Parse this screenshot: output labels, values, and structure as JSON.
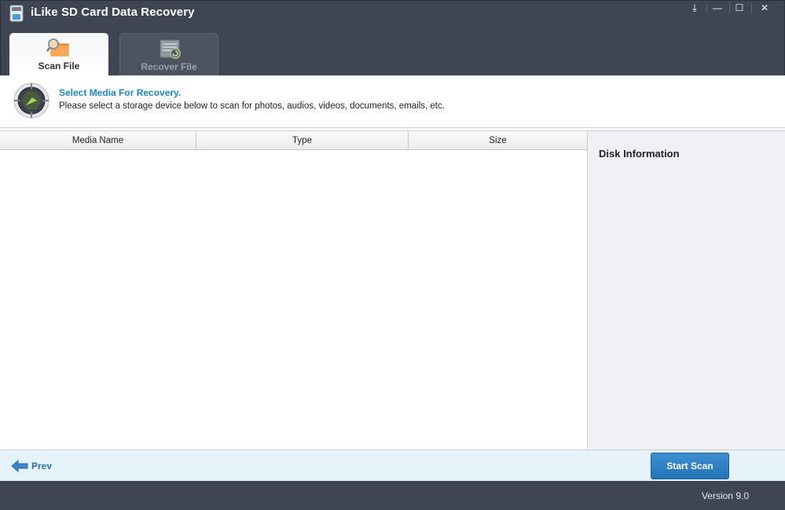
{
  "app": {
    "title": "iLike SD Card Data Recovery"
  },
  "window_controls": [
    {
      "name": "download-icon",
      "glyph": "⤓"
    },
    {
      "name": "minimize-icon",
      "glyph": "—"
    },
    {
      "name": "maximize-icon",
      "glyph": "☐"
    },
    {
      "name": "close-icon",
      "glyph": "✕"
    }
  ],
  "tabs": [
    {
      "label": "Scan File",
      "icon": "scan-folder-icon",
      "active": true
    },
    {
      "label": "Recover File",
      "icon": "recover-document-icon",
      "active": false
    }
  ],
  "header": {
    "title": "Select Media For Recovery.",
    "description": "Please select a storage device below to scan for photos, audios, videos, documents, emails, etc.",
    "icon": "media-target-icon"
  },
  "table": {
    "columns": [
      "Media Name",
      "Type",
      "Size"
    ],
    "rows": []
  },
  "disk_panel": {
    "title": "Disk Information"
  },
  "nav": {
    "prev_label": "Prev",
    "start_label": "Start Scan"
  },
  "footer": {
    "version": "Version 9.0"
  },
  "colors": {
    "titlebar": "#3e4653",
    "accent_blue": "#1a8ac8",
    "button_blue": "#2373b8",
    "nav_bg": "#e7f3fa",
    "panel_bg": "#eff1f3"
  }
}
